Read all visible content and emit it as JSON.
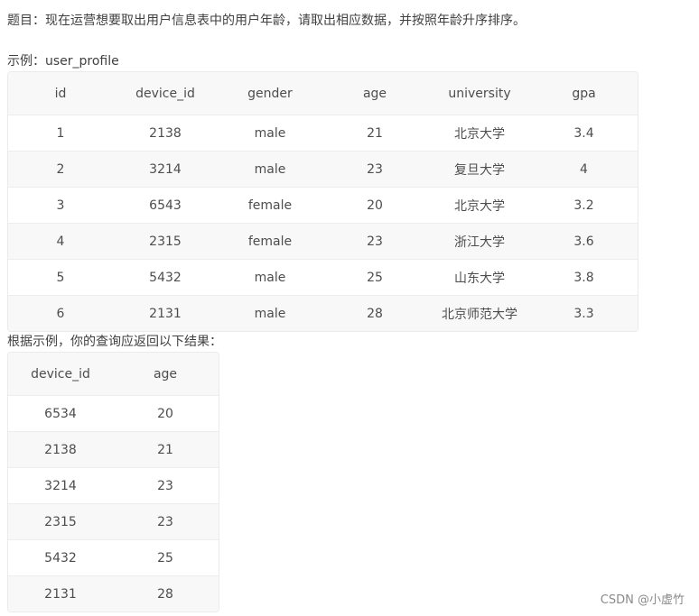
{
  "question": "题目：现在运营想要取出用户信息表中的用户年龄，请取出相应数据，并按照年龄升序排序。",
  "example_label": "示例：user_profile",
  "profile_table": {
    "headers": [
      "id",
      "device_id",
      "gender",
      "age",
      "university",
      "gpa"
    ],
    "rows": [
      [
        "1",
        "2138",
        "male",
        "21",
        "北京大学",
        "3.4"
      ],
      [
        "2",
        "3214",
        "male",
        "23",
        "复旦大学",
        "4"
      ],
      [
        "3",
        "6543",
        "female",
        "20",
        "北京大学",
        "3.2"
      ],
      [
        "4",
        "2315",
        "female",
        "23",
        "浙江大学",
        "3.6"
      ],
      [
        "5",
        "5432",
        "male",
        "25",
        "山东大学",
        "3.8"
      ],
      [
        "6",
        "2131",
        "male",
        "28",
        "北京师范大学",
        "3.3"
      ]
    ]
  },
  "result_label": "根据示例，你的查询应返回以下结果：",
  "result_table": {
    "headers": [
      "device_id",
      "age"
    ],
    "rows": [
      [
        "6534",
        "20"
      ],
      [
        "2138",
        "21"
      ],
      [
        "3214",
        "23"
      ],
      [
        "2315",
        "23"
      ],
      [
        "5432",
        "25"
      ],
      [
        "2131",
        "28"
      ]
    ]
  },
  "watermark": "CSDN @小虚竹"
}
